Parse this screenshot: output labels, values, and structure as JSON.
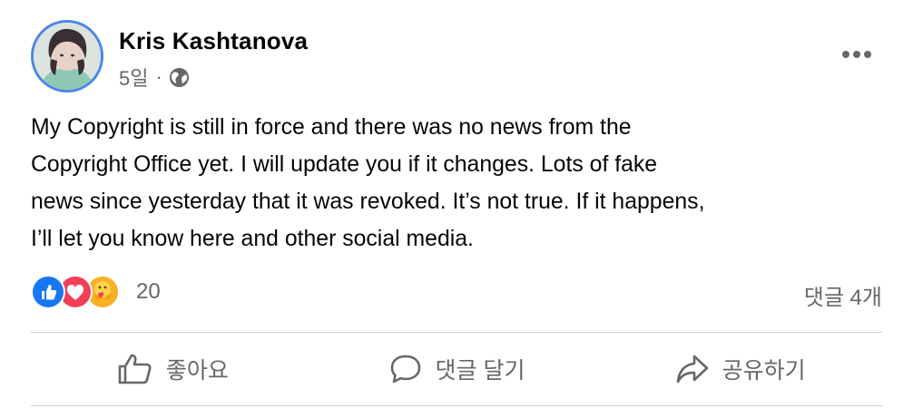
{
  "post": {
    "author": {
      "name": "Kris Kashtanova"
    },
    "meta": {
      "time": "5일",
      "separator": "·",
      "audience_icon": "globe-icon"
    },
    "more_icon": "more-options-icon",
    "text": "My Copyright is still in force and there was no news from the\nCopyright Office yet. I will update you if it changes. Lots of fake\nnews since yesterday that it was revoked. It’s not true. If it happens,\nI’ll let you know here and other social media.",
    "reactions": {
      "icons": [
        "like-icon",
        "love-icon",
        "care-icon"
      ],
      "count": "20"
    },
    "comment_count": "댓글 4개",
    "actions": [
      {
        "label": "좋아요",
        "icon": "thumbs-up-icon"
      },
      {
        "label": "댓글 달기",
        "icon": "comment-icon"
      },
      {
        "label": "공유하기",
        "icon": "share-icon"
      }
    ]
  },
  "colors": {
    "brand": "#1877f2",
    "love": "#f33e58",
    "care": "#f7b125",
    "secondary_text": "#65676b",
    "divider": "#ced0d4",
    "avatar_ring": "#4c87e6"
  }
}
